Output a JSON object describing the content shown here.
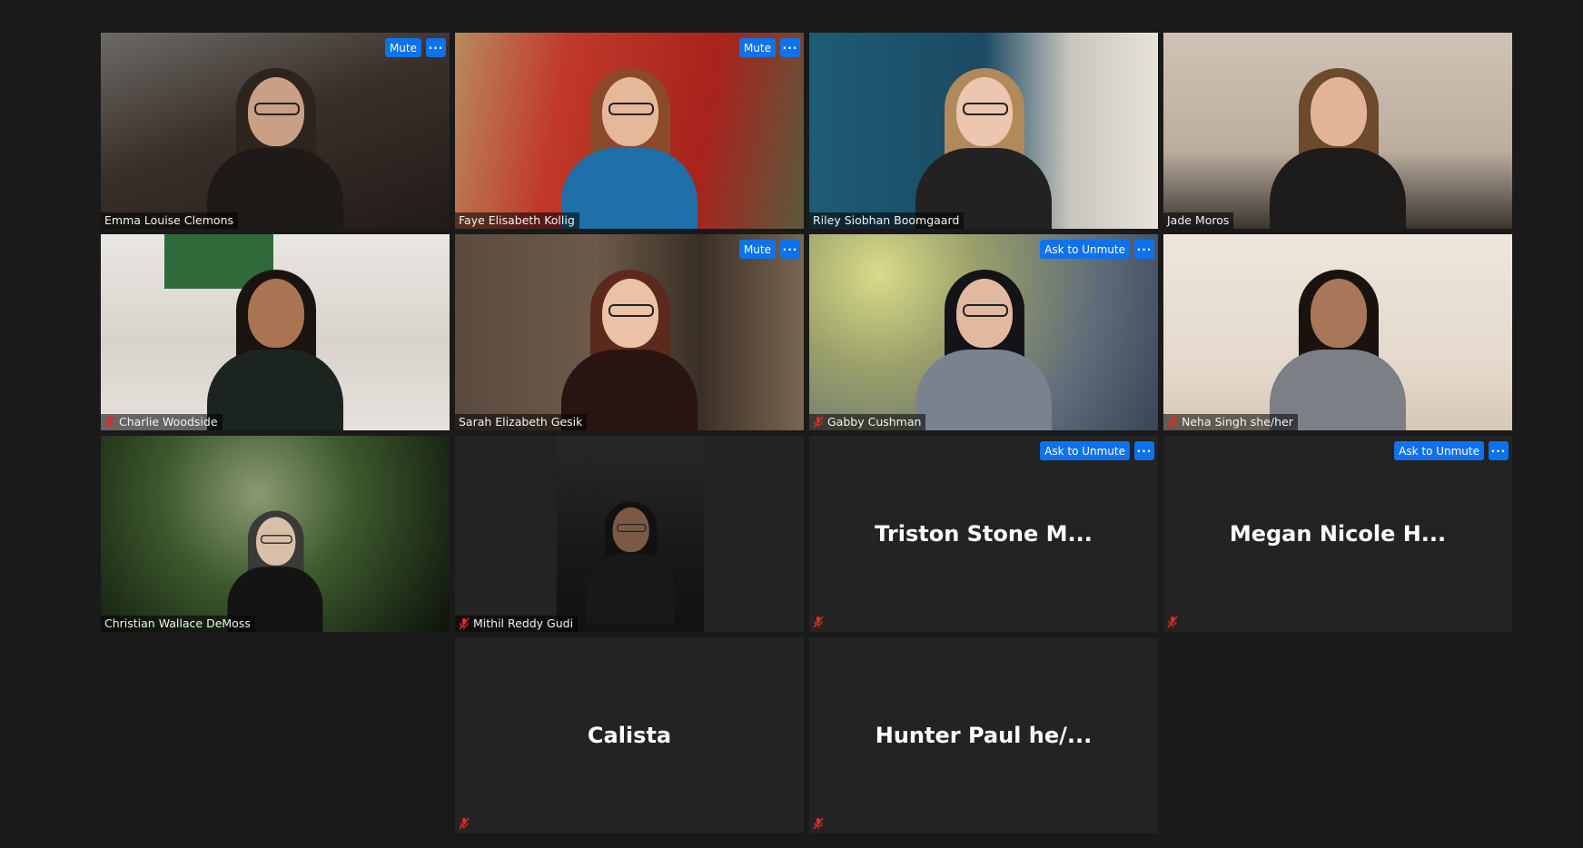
{
  "colors": {
    "background": "#1a1a1a",
    "tile": "#232323",
    "button": "#0e72ed",
    "active_speaker": "#d7e06a",
    "muted_icon": "#e02828"
  },
  "buttons": {
    "mute": "Mute",
    "ask_to_unmute": "Ask to Unmute",
    "more": "···"
  },
  "participants": [
    {
      "name": "Emma Louise Clemons",
      "muted": false,
      "video": true
    },
    {
      "name": "Faye Elisabeth Kollig",
      "muted": false,
      "video": true,
      "active_speaker": true
    },
    {
      "name": "Riley Siobhan Boomgaard",
      "muted": false,
      "video": true
    },
    {
      "name": "Jade Moros",
      "muted": false,
      "video": true
    },
    {
      "name": "Charlie Woodside",
      "muted": true,
      "video": true
    },
    {
      "name": "Sarah Elizabeth Gesik",
      "muted": false,
      "video": true
    },
    {
      "name": "Gabby Cushman",
      "muted": true,
      "video": true
    },
    {
      "name": "Neha Singh she/her",
      "muted": true,
      "video": true
    },
    {
      "name": "Christian Wallace DeMoss",
      "muted": false,
      "video": true
    },
    {
      "name": "Mithil Reddy Gudi",
      "muted": true,
      "video": true
    },
    {
      "name": "Triston Stone M...",
      "muted": true,
      "video": false
    },
    {
      "name": "Megan Nicole H...",
      "muted": true,
      "video": false
    },
    {
      "name": "Calista",
      "muted": true,
      "video": false
    },
    {
      "name": "Hunter Paul he/...",
      "muted": true,
      "video": false
    }
  ]
}
